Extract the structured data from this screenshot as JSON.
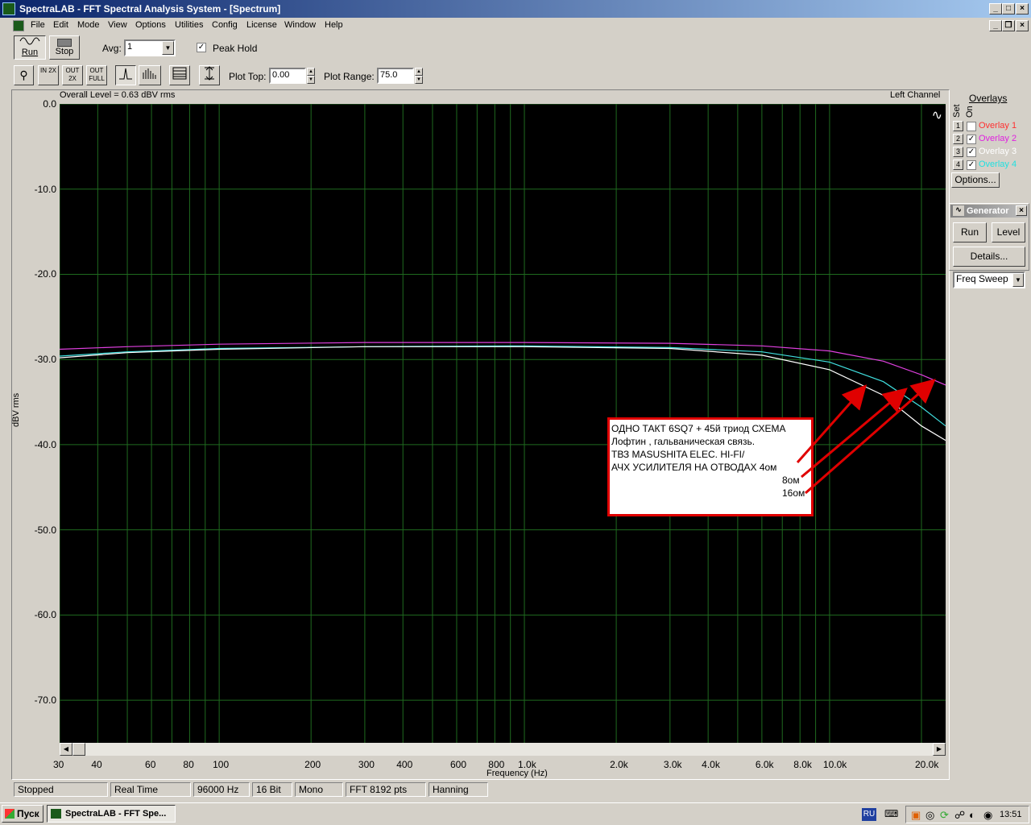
{
  "window": {
    "title": "SpectraLAB - FFT Spectral Analysis System - [Spectrum]"
  },
  "menu": [
    "File",
    "Edit",
    "Mode",
    "View",
    "Options",
    "Utilities",
    "Config",
    "License",
    "Window",
    "Help"
  ],
  "toolbar1": {
    "run_label": "Run",
    "stop_label": "Stop",
    "avg_label": "Avg:",
    "avg_value": "1",
    "peak_hold_label": "Peak Hold",
    "peak_hold_checked": true
  },
  "toolbar2": {
    "zoom_in_label": "IN 2X",
    "zoom_out_label": "OUT 2X",
    "zoom_full_label": "OUT FULL",
    "plot_top_label": "Plot Top:",
    "plot_top_value": "0.00",
    "plot_range_label": "Plot Range:",
    "plot_range_value": "75.0"
  },
  "plot": {
    "overall_level": "Overall Level = 0.63 dBV rms",
    "channel": "Left Channel",
    "y_label": "dBV rms",
    "x_label": "Frequency (Hz)",
    "note_lines": [
      "ОДНО ТАКТ  6SQ7 + 45й  триод   СХЕМА",
      "Лофтин   , гальваническая  связь.",
      "ТВЗ  MASUSHITA  ELEC.  HI-FI/",
      "АЧХ  УСИЛИТЕЛЯ НА  ОТВОДАХ  4ом"
    ],
    "note_8": "8ом",
    "note_16": "16ом"
  },
  "chart_data": {
    "type": "line",
    "x_scale": "log",
    "xlim": [
      30,
      24000
    ],
    "ylim": [
      -75,
      0
    ],
    "yticks": [
      "0.0",
      "-10.0",
      "-20.0",
      "-30.0",
      "-40.0",
      "-50.0",
      "-60.0",
      "-70.0"
    ],
    "xticks": [
      {
        "v": 30,
        "label": "30"
      },
      {
        "v": 40,
        "label": "40"
      },
      {
        "v": 60,
        "label": "60"
      },
      {
        "v": 80,
        "label": "80"
      },
      {
        "v": 100,
        "label": "100"
      },
      {
        "v": 200,
        "label": "200"
      },
      {
        "v": 300,
        "label": "300"
      },
      {
        "v": 400,
        "label": "400"
      },
      {
        "v": 600,
        "label": "600"
      },
      {
        "v": 800,
        "label": "800"
      },
      {
        "v": 1000,
        "label": "1.0k"
      },
      {
        "v": 2000,
        "label": "2.0k"
      },
      {
        "v": 3000,
        "label": "3.0k"
      },
      {
        "v": 4000,
        "label": "4.0k"
      },
      {
        "v": 6000,
        "label": "6.0k"
      },
      {
        "v": 8000,
        "label": "8.0k"
      },
      {
        "v": 10000,
        "label": "10.0k"
      },
      {
        "v": 20000,
        "label": "20.0k"
      }
    ],
    "series": [
      {
        "color": "#e040e0",
        "x": [
          30,
          50,
          100,
          300,
          1000,
          3000,
          6000,
          10000,
          15000,
          20000,
          24000
        ],
        "y": [
          -28.8,
          -28.5,
          -28.2,
          -28.0,
          -28.0,
          -28.1,
          -28.4,
          -29.0,
          -30.2,
          -31.8,
          -33.0
        ]
      },
      {
        "color": "#40e0e0",
        "x": [
          30,
          50,
          100,
          300,
          1000,
          3000,
          6000,
          10000,
          15000,
          20000,
          24000
        ],
        "y": [
          -29.6,
          -29.1,
          -28.7,
          -28.5,
          -28.4,
          -28.6,
          -29.1,
          -30.3,
          -32.6,
          -35.6,
          -37.8
        ]
      },
      {
        "color": "#ffffff",
        "x": [
          30,
          50,
          100,
          300,
          1000,
          3000,
          6000,
          10000,
          15000,
          20000,
          24000
        ],
        "y": [
          -29.8,
          -29.2,
          -28.8,
          -28.5,
          -28.5,
          -28.7,
          -29.5,
          -31.2,
          -34.2,
          -37.8,
          -39.5
        ]
      }
    ]
  },
  "overlays": {
    "title": "Overlays",
    "set_label": "Set",
    "on_label": "On",
    "items": [
      {
        "num": "1",
        "label": "Overlay 1",
        "color": "#ff3030",
        "checked": false
      },
      {
        "num": "2",
        "label": "Overlay 2",
        "color": "#e020e0",
        "checked": true
      },
      {
        "num": "3",
        "label": "Overlay 3",
        "color": "#ffffff",
        "checked": true
      },
      {
        "num": "4",
        "label": "Overlay 4",
        "color": "#20e0e0",
        "checked": true
      }
    ],
    "options_label": "Options..."
  },
  "generator": {
    "title": "Generator",
    "run_label": "Run",
    "level_label": "Level",
    "details_label": "Details...",
    "mode_value": "Freq Sweep"
  },
  "status": [
    "Stopped",
    "Real Time",
    "96000 Hz",
    "16 Bit",
    "Mono",
    "FFT 8192 pts",
    "Hanning"
  ],
  "taskbar": {
    "start_label": "Пуск",
    "task_label": "SpectraLAB - FFT Spe...",
    "lang": "RU",
    "clock": "13:51"
  }
}
